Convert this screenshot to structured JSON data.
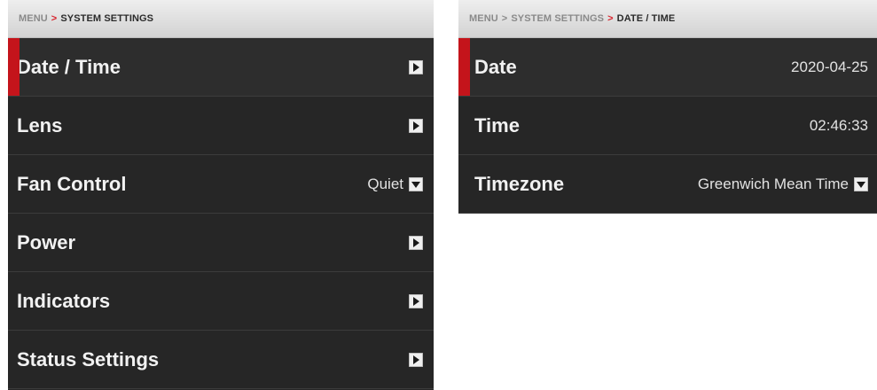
{
  "left_panel": {
    "breadcrumb": {
      "root": "MENU",
      "separator": ">",
      "current": "SYSTEM SETTINGS"
    },
    "items": [
      {
        "label": "Date / Time",
        "value": "",
        "control": "arrow-right-icon"
      },
      {
        "label": "Lens",
        "value": "",
        "control": "arrow-right-icon"
      },
      {
        "label": "Fan Control",
        "value": "Quiet",
        "control": "dropdown-arrow-icon"
      },
      {
        "label": "Power",
        "value": "",
        "control": "arrow-right-icon"
      },
      {
        "label": "Indicators",
        "value": "",
        "control": "arrow-right-icon"
      },
      {
        "label": "Status Settings",
        "value": "",
        "control": "arrow-right-icon"
      }
    ]
  },
  "right_panel": {
    "breadcrumb": {
      "root": "MENU",
      "separator1": ">",
      "parent": "SYSTEM SETTINGS",
      "separator2": ">",
      "current": "DATE / TIME"
    },
    "items": [
      {
        "label": "Date",
        "value": "2020-04-25"
      },
      {
        "label": "Time",
        "value": "02:46:33"
      },
      {
        "label": "Timezone",
        "value": "Greenwich Mean Time",
        "control": "dropdown-arrow-icon"
      }
    ]
  },
  "colors": {
    "panel_bg": "#262626",
    "selected_accent": "#c4141b",
    "breadcrumb_separator": "#d8202a"
  }
}
